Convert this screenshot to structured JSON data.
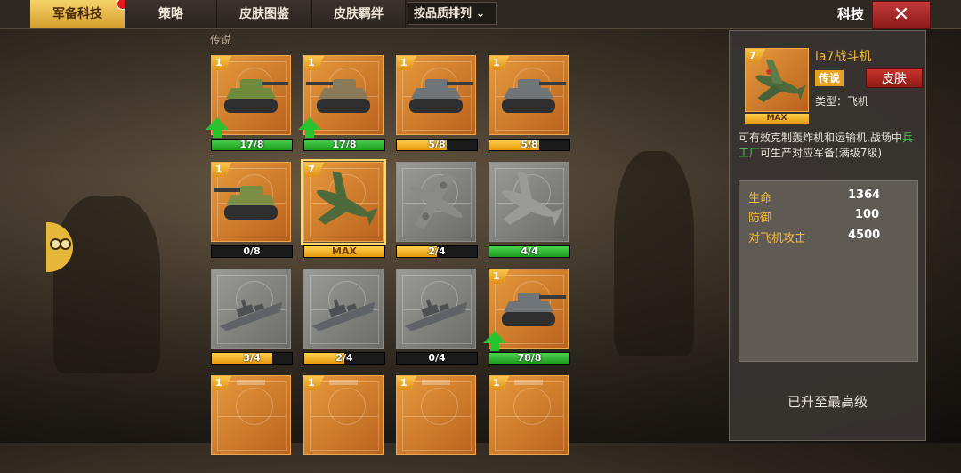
{
  "tabs": [
    {
      "label": "军备科技",
      "active": true,
      "badge": true
    },
    {
      "label": "策略",
      "active": false
    },
    {
      "label": "皮肤图鉴",
      "active": false
    },
    {
      "label": "皮肤羁绊",
      "active": false
    }
  ],
  "sort": {
    "label": "按品质排列"
  },
  "title": "科技",
  "close_label": "✕",
  "category": "传说",
  "cards": [
    {
      "level": "1",
      "type": "tank",
      "style": "orange",
      "bar_text": "17/8",
      "progress": 1.0,
      "bar_color": "green",
      "upgradable": true,
      "selected": false
    },
    {
      "level": "1",
      "type": "spg",
      "style": "orange",
      "bar_text": "17/8",
      "progress": 1.0,
      "bar_color": "green",
      "upgradable": true,
      "selected": false
    },
    {
      "level": "1",
      "type": "tank-gray",
      "style": "orange",
      "bar_text": "5/8",
      "progress": 0.625,
      "bar_color": "yellow",
      "upgradable": false,
      "selected": false
    },
    {
      "level": "1",
      "type": "tank-gray",
      "style": "orange",
      "bar_text": "5/8",
      "progress": 0.625,
      "bar_color": "yellow",
      "upgradable": false,
      "selected": false
    },
    {
      "level": "1",
      "type": "spg-green",
      "style": "orange",
      "bar_text": "0/8",
      "progress": 0.0,
      "bar_color": "yellow",
      "upgradable": false,
      "selected": false
    },
    {
      "level": "7",
      "type": "fighter",
      "style": "orange",
      "bar_text": "MAX",
      "progress": 1.0,
      "bar_color": "yellow",
      "upgradable": false,
      "selected": true
    },
    {
      "level": "",
      "type": "bomber",
      "style": "gray",
      "bar_text": "2/4",
      "progress": 0.5,
      "bar_color": "yellow",
      "upgradable": false,
      "selected": false
    },
    {
      "level": "",
      "type": "fighter-gray",
      "style": "gray",
      "bar_text": "4/4",
      "progress": 1.0,
      "bar_color": "green",
      "upgradable": false,
      "selected": false
    },
    {
      "level": "",
      "type": "ship",
      "style": "gray",
      "bar_text": "3/4",
      "progress": 0.75,
      "bar_color": "yellow",
      "upgradable": false,
      "selected": false
    },
    {
      "level": "",
      "type": "ship",
      "style": "gray",
      "bar_text": "2/4",
      "progress": 0.5,
      "bar_color": "yellow",
      "upgradable": false,
      "selected": false
    },
    {
      "level": "",
      "type": "ship",
      "style": "gray",
      "bar_text": "0/4",
      "progress": 0.0,
      "bar_color": "yellow",
      "upgradable": false,
      "selected": false
    },
    {
      "level": "1",
      "type": "heavy-tank",
      "style": "orange",
      "bar_text": "78/8",
      "progress": 1.0,
      "bar_color": "green",
      "upgradable": true,
      "selected": false
    },
    {
      "level": "1",
      "type": "partial",
      "style": "orange",
      "bar_text": "",
      "progress": 0,
      "bar_color": "yellow",
      "upgradable": false,
      "selected": false
    },
    {
      "level": "1",
      "type": "partial",
      "style": "orange",
      "bar_text": "",
      "progress": 0,
      "bar_color": "yellow",
      "upgradable": false,
      "selected": false
    },
    {
      "level": "1",
      "type": "partial",
      "style": "orange",
      "bar_text": "",
      "progress": 0,
      "bar_color": "yellow",
      "upgradable": false,
      "selected": false
    },
    {
      "level": "1",
      "type": "partial",
      "style": "orange",
      "bar_text": "",
      "progress": 0,
      "bar_color": "yellow",
      "upgradable": false,
      "selected": false
    }
  ],
  "detail": {
    "level": "7",
    "name": "la7战斗机",
    "rarity": "传说",
    "skin_label": "皮肤",
    "type_line": "类型：飞机",
    "max_label": "MAX",
    "desc_prefix": "可有效克制轰炸机和运输机,战场中",
    "desc_highlight": "兵工厂",
    "desc_suffix": "可生产对应军备(满级7级)",
    "stats": [
      {
        "label": "生命",
        "value": "1364"
      },
      {
        "label": "防御",
        "value": "100"
      },
      {
        "label": "对飞机攻击",
        "value": "4500"
      }
    ],
    "footer": "已升至最高级"
  },
  "colors": {
    "accent": "#f3b83b",
    "green": "#29c32f",
    "close": "#c33a3a"
  }
}
